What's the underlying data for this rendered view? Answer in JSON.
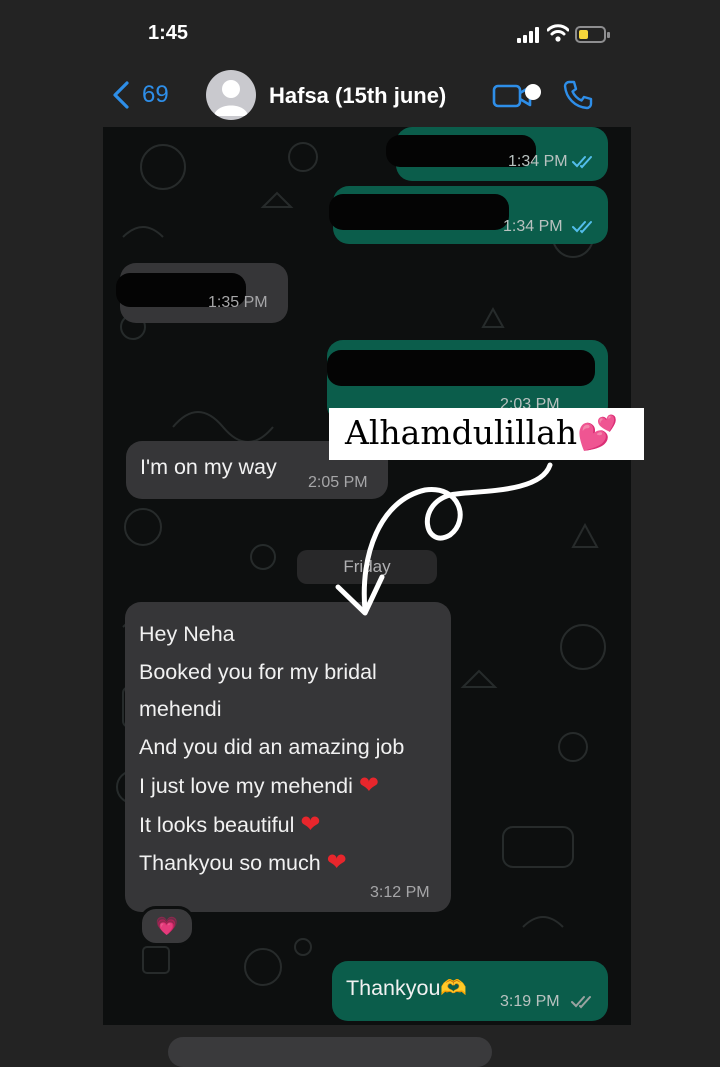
{
  "status_bar": {
    "time": "1:45"
  },
  "header": {
    "back_count": "69",
    "contact_name": "Hafsa (15th june)"
  },
  "messages": [
    {
      "direction": "out",
      "text": "",
      "time": "1:34 PM",
      "read": true
    },
    {
      "direction": "out",
      "text": "",
      "time": "1:34 PM",
      "read": true
    },
    {
      "direction": "in",
      "text": "",
      "time": "1:35 PM"
    },
    {
      "direction": "out",
      "text": "",
      "time": "2:03 PM",
      "read": true
    },
    {
      "direction": "in",
      "text": "I'm on my way",
      "time": "2:05 PM"
    }
  ],
  "date_separator": "Friday",
  "long_message": {
    "lines": [
      "Hey Neha",
      "Booked you for my bridal",
      "mehendi",
      "And you did an amazing job",
      "I just love my mehendi",
      "It looks beautiful",
      "Thankyou so much"
    ],
    "time": "3:12 PM",
    "reaction": "💗"
  },
  "last_message": {
    "text": "Thankyou",
    "emoji": "🫶",
    "time": "3:19 PM",
    "read": true
  },
  "overlay": {
    "label": "Alhamdulillah",
    "emoji": "💕"
  },
  "colors": {
    "accent": "#2e8ee8",
    "outgoing_bubble": "#0b5d4b",
    "incoming_bubble": "#363638",
    "read_ticks": "#53bdeb"
  }
}
